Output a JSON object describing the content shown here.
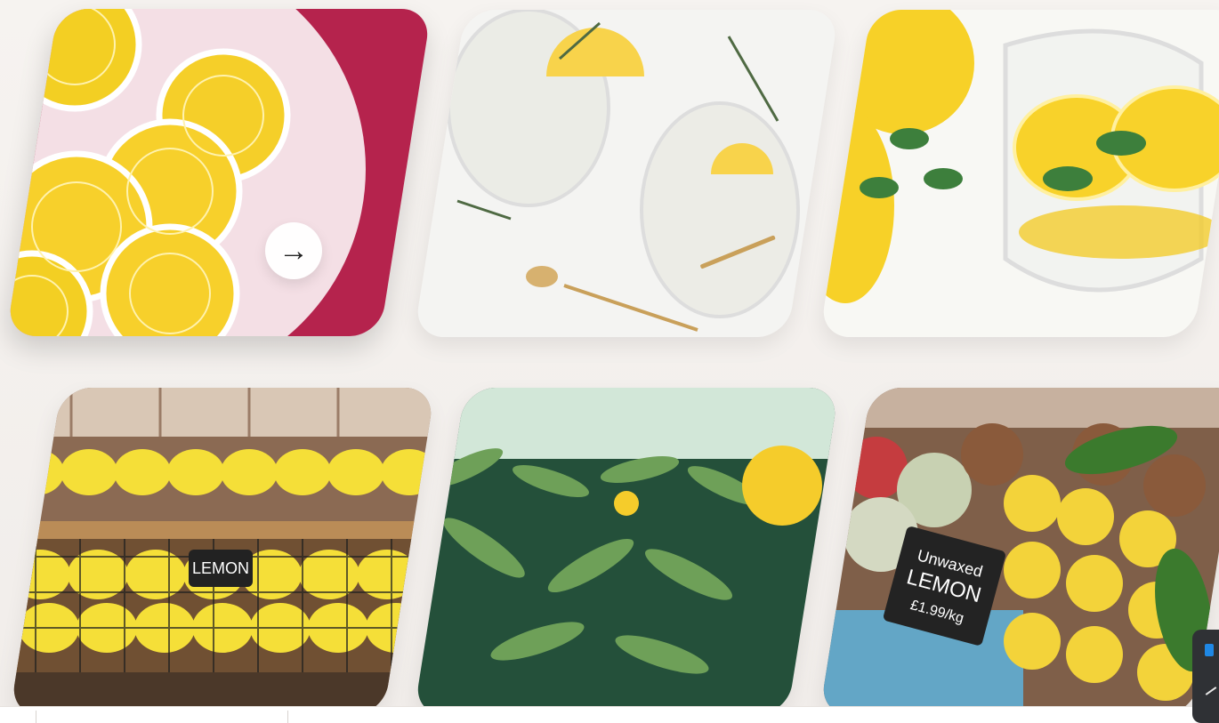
{
  "gallery": {
    "cards": [
      {
        "name": "sliced-lemons-plate-image",
        "type": "image",
        "theme": "sliced lemons on plate"
      },
      {
        "name": "lemonade-glasses-image",
        "type": "image",
        "theme": "lemonade glasses"
      },
      {
        "name": "lemon-water-glass-image",
        "type": "image",
        "theme": "lemon water glass"
      },
      {
        "name": "lemon-crate-image",
        "type": "image",
        "theme": "lemon crate"
      },
      {
        "name": "lemon-tree-image",
        "type": "image",
        "theme": "lemon tree"
      },
      {
        "name": "market-lemons-image",
        "type": "image",
        "theme": "market lemons"
      }
    ],
    "crate_sign_text": "LEMON",
    "market_sign_line1": "Unwaxed",
    "market_sign_line2": "LEMON",
    "market_sign_line3": "£1.99/kg",
    "next_icon": "arrow-right-icon"
  }
}
